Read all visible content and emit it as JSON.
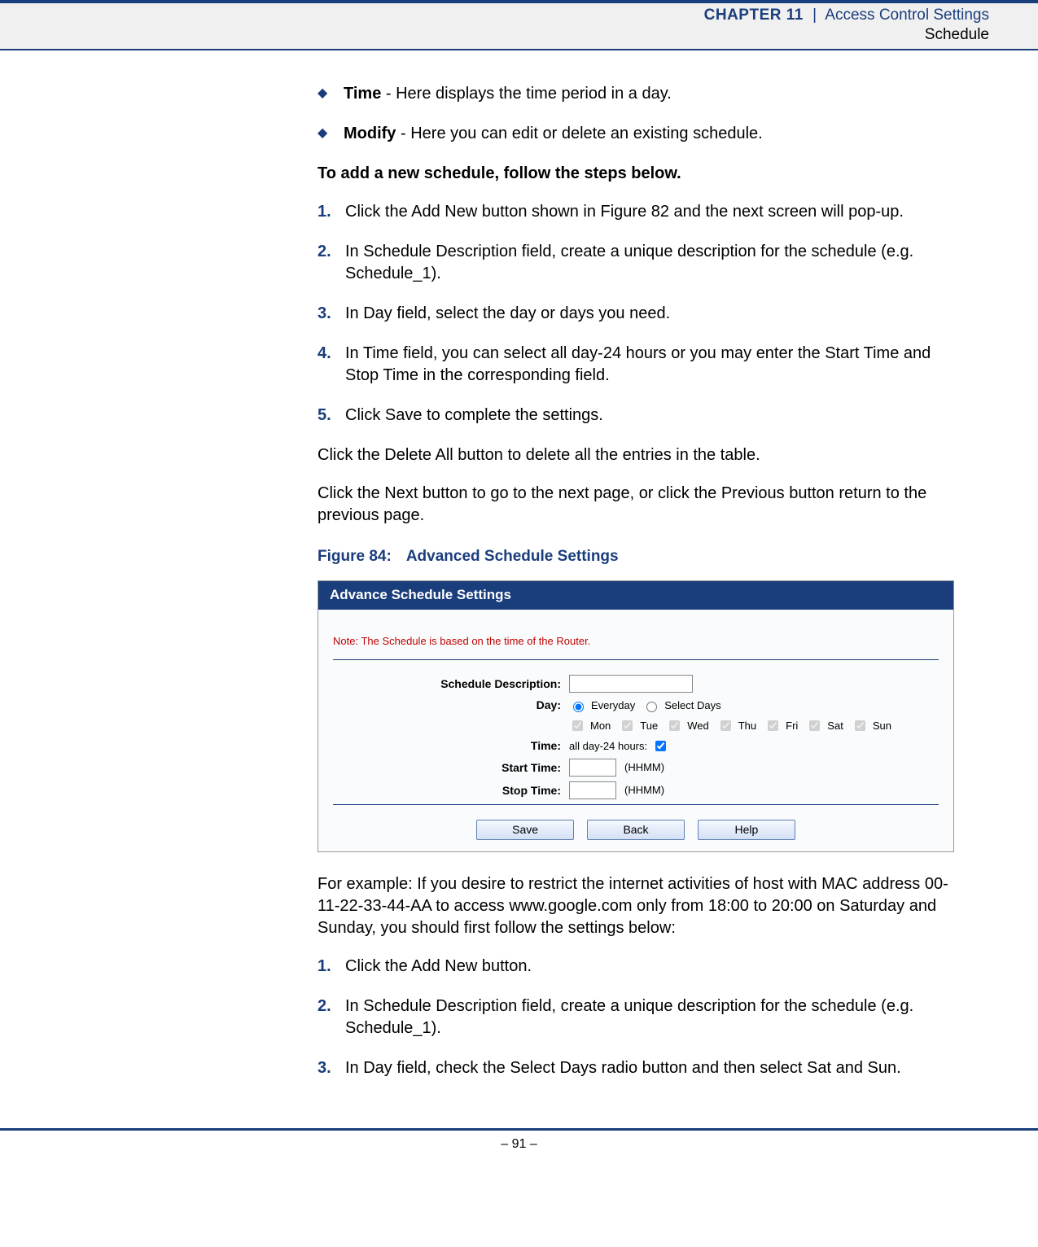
{
  "header": {
    "chapter": "CHAPTER 11",
    "separator": "|",
    "title": "Access Control Settings",
    "subtitle": "Schedule"
  },
  "bullets": [
    {
      "term": "Time",
      "text": " - Here displays the time period in a day."
    },
    {
      "term": "Modify",
      "text": " - Here you can edit or delete an existing schedule."
    }
  ],
  "section_head": "To add a new schedule, follow the steps below.",
  "steps_a": [
    {
      "n": "1.",
      "text": "Click the Add New button shown in Figure 82 and the next screen will pop-up."
    },
    {
      "n": "2.",
      "text": "In Schedule Description field, create a unique description for the schedule (e.g. Schedule_1)."
    },
    {
      "n": "3.",
      "text": "In Day field, select the day or days you need."
    },
    {
      "n": "4.",
      "text": "In Time field, you can select all day-24 hours or you may enter the Start Time and Stop Time in the corresponding field."
    },
    {
      "n": "5.",
      "text": "Click Save to complete the settings."
    }
  ],
  "para_delete": "Click the Delete All button to delete all the entries in the table.",
  "para_next": "Click the Next button to go to the next page, or click the Previous button return to the previous page.",
  "figure_caption_prefix": "Figure 84:",
  "figure_caption_title": "Advanced Schedule Settings",
  "panel": {
    "title": "Advance Schedule Settings",
    "note": "Note: The Schedule is based on the time of the Router.",
    "labels": {
      "desc": "Schedule Description:",
      "day": "Day:",
      "time": "Time:",
      "start": "Start Time:",
      "stop": "Stop Time:"
    },
    "day_options": {
      "everyday": "Everyday",
      "select": "Select Days"
    },
    "days": [
      "Mon",
      "Tue",
      "Wed",
      "Thu",
      "Fri",
      "Sat",
      "Sun"
    ],
    "time_allday": "all day-24 hours:",
    "hhmm": "(HHMM)",
    "buttons": {
      "save": "Save",
      "back": "Back",
      "help": "Help"
    }
  },
  "example_para": "For example: If you desire to restrict the internet activities of host with MAC address 00-11-22-33-44-AA to access www.google.com only from 18:00 to 20:00 on Saturday and Sunday, you should first follow the settings below:",
  "steps_b": [
    {
      "n": "1.",
      "text": "Click the Add New button."
    },
    {
      "n": "2.",
      "text": "In Schedule Description field, create a unique description for the schedule (e.g. Schedule_1)."
    },
    {
      "n": "3.",
      "text": "In Day field, check the Select Days radio button and then select Sat and Sun."
    }
  ],
  "page_number": "–  91  –"
}
